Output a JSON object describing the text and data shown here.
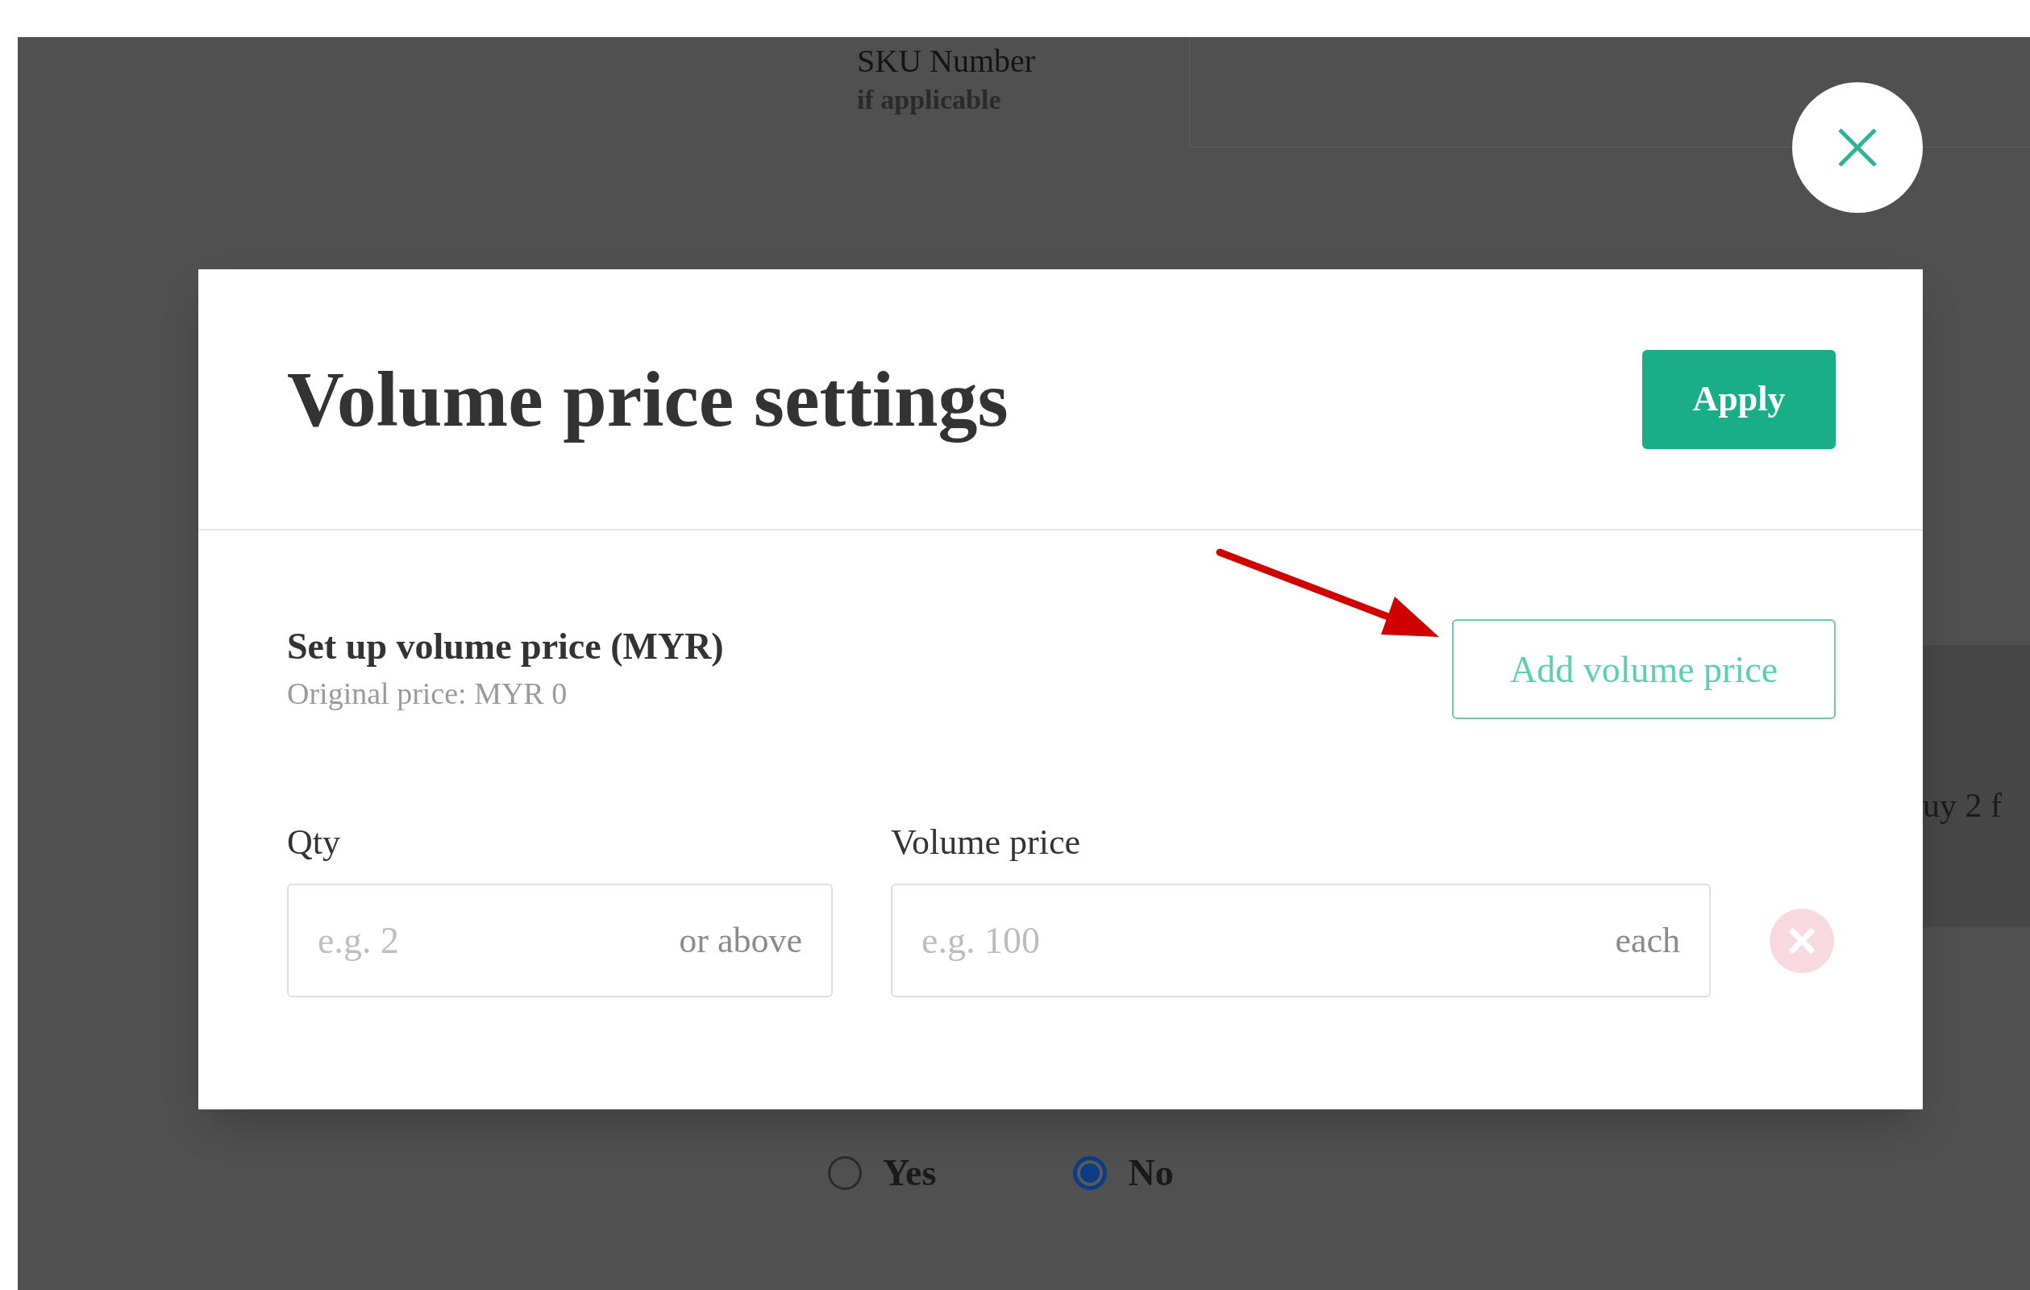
{
  "background": {
    "sku_label": "SKU Number",
    "sku_hint": "if applicable",
    "side_text": "uy 2 f",
    "options": [
      {
        "label": "Yes",
        "selected": false
      },
      {
        "label": "No",
        "selected": true
      }
    ]
  },
  "modal": {
    "title": "Volume price settings",
    "apply": "Apply",
    "section_title": "Set up volume price (MYR)",
    "original_price": "Original price: MYR 0",
    "add_button": "Add volume price",
    "fields": [
      {
        "label": "Qty",
        "placeholder": "e.g. 2",
        "suffix": "or above"
      },
      {
        "label": "Volume price",
        "placeholder": "e.g. 100",
        "suffix": "each"
      }
    ]
  }
}
